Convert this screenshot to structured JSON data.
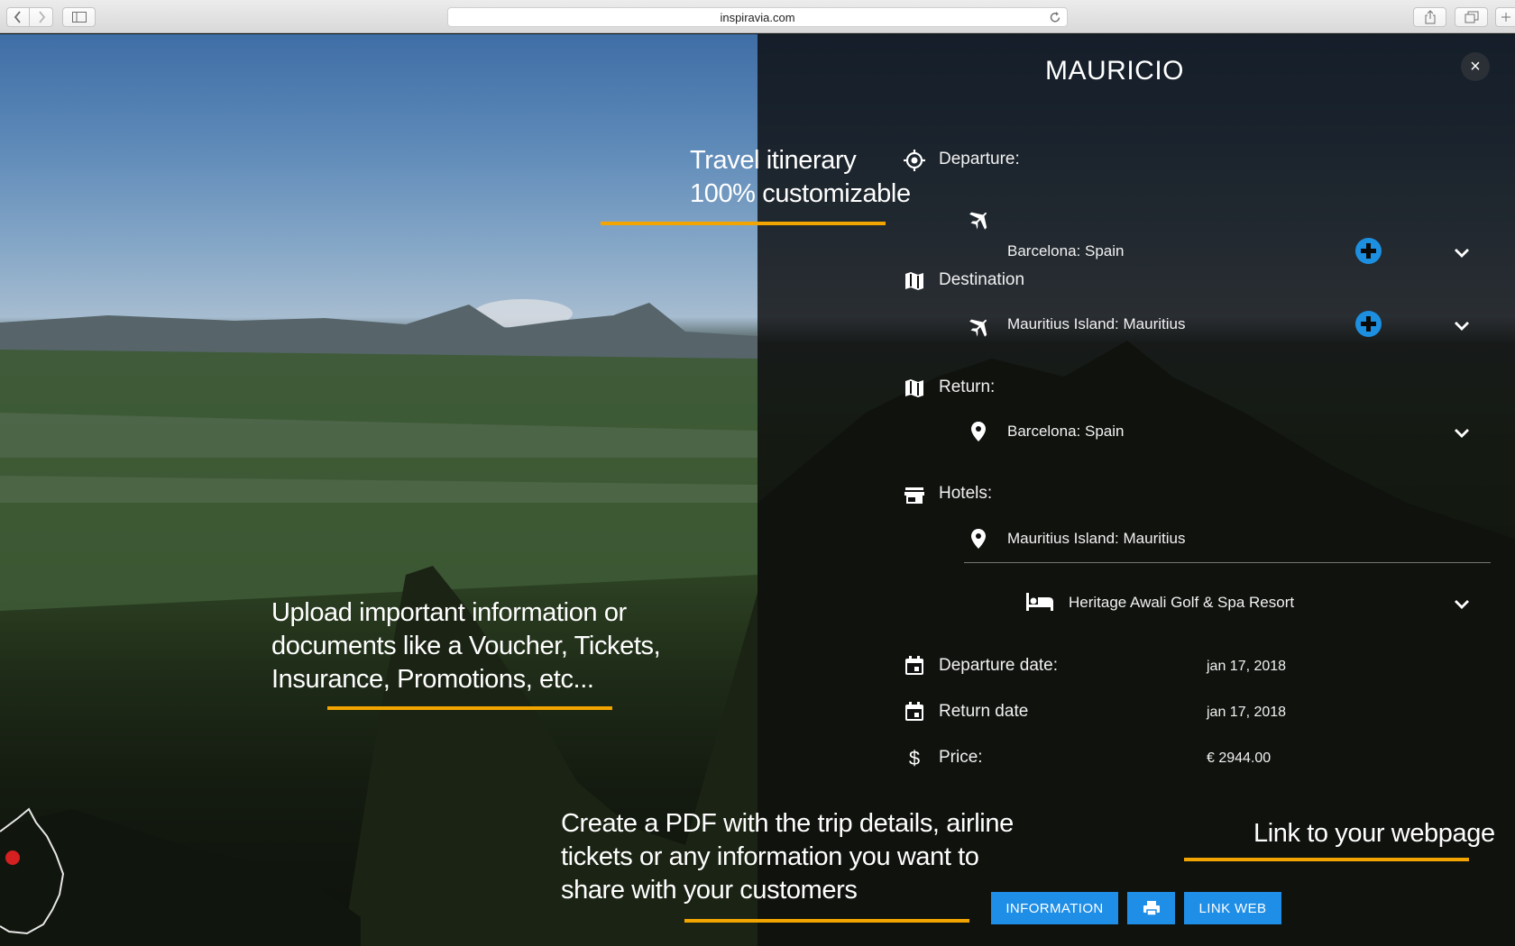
{
  "browser": {
    "url": "inspiravia.com"
  },
  "panel": {
    "title": "MAURICIO",
    "close_label": "×"
  },
  "itinerary": {
    "departure_label": "Departure:",
    "departure_place": "Barcelona: Spain",
    "destination_label": "Destination",
    "destination_place": "Mauritius Island: Mauritius",
    "return_label": "Return:",
    "return_place": "Barcelona: Spain",
    "hotels_label": "Hotels:",
    "hotels_place": "Mauritius Island: Mauritius",
    "hotel_name": "Heritage Awali Golf & Spa Resort",
    "departure_date_label": "Departure date:",
    "departure_date_value": "jan 17, 2018",
    "return_date_label": "Return date",
    "return_date_value": "jan 17, 2018",
    "price_label": "Price:",
    "price_value": "€ 2944.00"
  },
  "callouts": {
    "itinerary_line1": "Travel itinerary",
    "itinerary_line2": "100% customizable",
    "upload_line1": "Upload important information or",
    "upload_line2": "documents like a Voucher, Tickets,",
    "upload_line3": "Insurance, Promotions, etc...",
    "pdf_line1": "Create a PDF with the trip details, airline",
    "pdf_line2": "tickets or any information you want to",
    "pdf_line3": "share with your customers",
    "link_web": "Link to your webpage"
  },
  "buttons": {
    "information": "INFORMATION",
    "link_web": "LINK WEB"
  },
  "colors": {
    "accent_blue": "#1f8ee6",
    "underline_orange": "#f2a500"
  },
  "icons": {
    "departure": "crosshair-icon",
    "flight": "airplane-icon",
    "destination": "map-icon",
    "location": "map-pin-icon",
    "hotels": "store-icon",
    "hotel": "bed-icon",
    "calendar": "calendar-icon",
    "price": "dollar-icon",
    "print": "printer-icon",
    "add": "plus-circle-icon",
    "expand": "chevron-down-icon"
  }
}
